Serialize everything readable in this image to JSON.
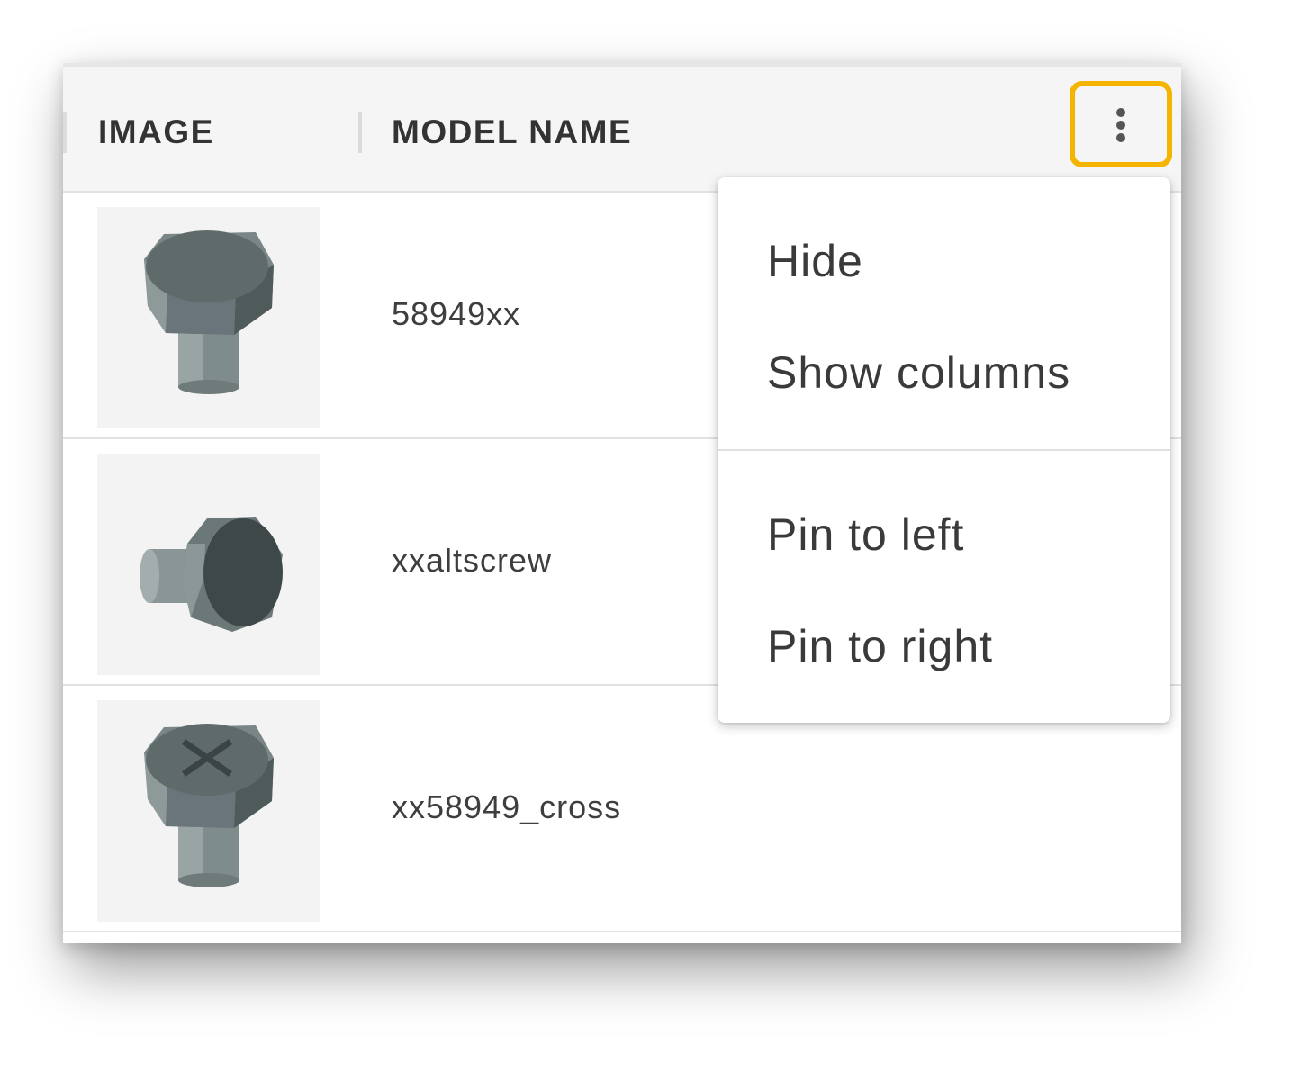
{
  "table": {
    "columns": {
      "image": "IMAGE",
      "model_name": "MODEL NAME"
    },
    "rows": [
      {
        "model_name": "58949xx",
        "thumbnail": "hex-bolt-upright"
      },
      {
        "model_name": "xxaltscrew",
        "thumbnail": "hex-bolt-sideways"
      },
      {
        "model_name": "xx58949_cross",
        "thumbnail": "hex-bolt-cross-head"
      }
    ]
  },
  "column_menu": {
    "trigger_icon": "more-vertical-icon",
    "highlight_color": "#f5b400",
    "items": [
      {
        "label": "Hide"
      },
      {
        "label": "Show columns"
      },
      {
        "label": "Pin to left"
      },
      {
        "label": "Pin to right"
      }
    ]
  }
}
